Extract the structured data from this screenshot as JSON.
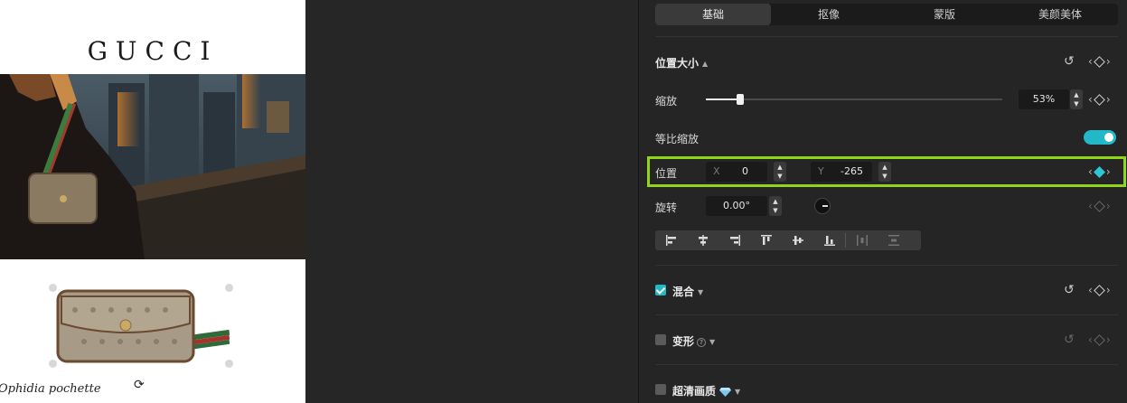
{
  "canvas": {
    "brand": "GUCCI",
    "caption": "Ophidia pochette"
  },
  "panel": {
    "tabs": [
      {
        "label": "基础",
        "active": true
      },
      {
        "label": "抠像",
        "active": false
      },
      {
        "label": "蒙版",
        "active": false
      },
      {
        "label": "美颜美体",
        "active": false
      }
    ],
    "position_size": {
      "title": "位置大小",
      "scale_label": "缩放",
      "scale_value": "53%",
      "scale_fraction": 0.116,
      "uniform_scale_label": "等比缩放",
      "uniform_scale_on": true,
      "position_label": "位置",
      "x_label": "X",
      "x_value": "0",
      "y_label": "Y",
      "y_value": "-265",
      "rotation_label": "旋转",
      "rotation_value": "0.00°"
    },
    "blend": {
      "label": "混合",
      "checked": true
    },
    "transform": {
      "label": "变形",
      "checked": false
    },
    "hd": {
      "label": "超清画质",
      "checked": false
    }
  },
  "colors": {
    "accent": "#22b8c8",
    "highlight": "#8ed616",
    "panel_bg": "#252525"
  }
}
